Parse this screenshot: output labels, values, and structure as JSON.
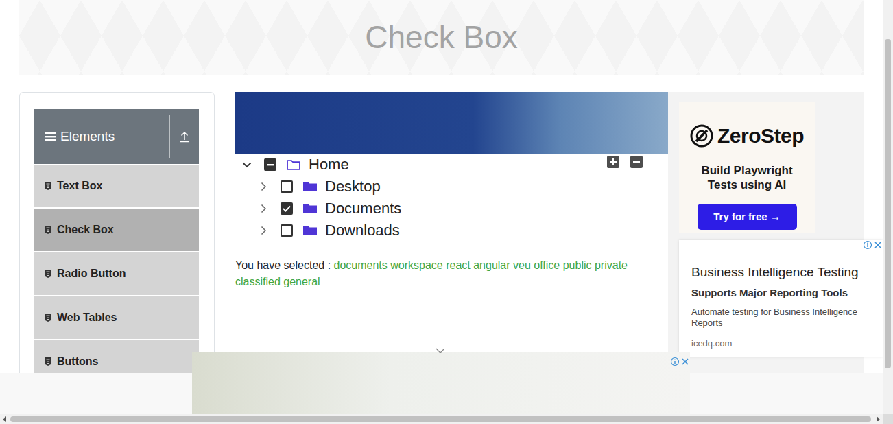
{
  "page": {
    "title": "Check Box"
  },
  "sidebar": {
    "group": {
      "label": "Elements",
      "expanded": true
    },
    "items": [
      {
        "label": "Text Box",
        "selected": false
      },
      {
        "label": "Check Box",
        "selected": true
      },
      {
        "label": "Radio Button",
        "selected": false
      },
      {
        "label": "Web Tables",
        "selected": false
      },
      {
        "label": "Buttons",
        "selected": false
      }
    ]
  },
  "tree": {
    "nodes": [
      {
        "label": "Home",
        "expanded": true,
        "checked": false,
        "indeterminate": true,
        "children": [
          {
            "label": "Desktop",
            "expanded": false,
            "checked": false,
            "indeterminate": false
          },
          {
            "label": "Documents",
            "expanded": false,
            "checked": true,
            "indeterminate": false
          },
          {
            "label": "Downloads",
            "expanded": false,
            "checked": false,
            "indeterminate": false
          }
        ]
      }
    ]
  },
  "result": {
    "label": "You have selected :",
    "items": [
      "documents",
      "workspace",
      "react",
      "angular",
      "veu",
      "office",
      "public",
      "private",
      "classified",
      "general"
    ]
  },
  "ads": {
    "side": {
      "brand": "ZeroStep",
      "headline": "Build Playwright Tests using AI",
      "button": "Try for free →"
    },
    "text": {
      "title": "Business Intelligence Testing",
      "subtitle": "Supports Major Reporting Tools",
      "body": "Automate testing for Business Intelligence Reports",
      "domain": "icedq.com"
    }
  }
}
